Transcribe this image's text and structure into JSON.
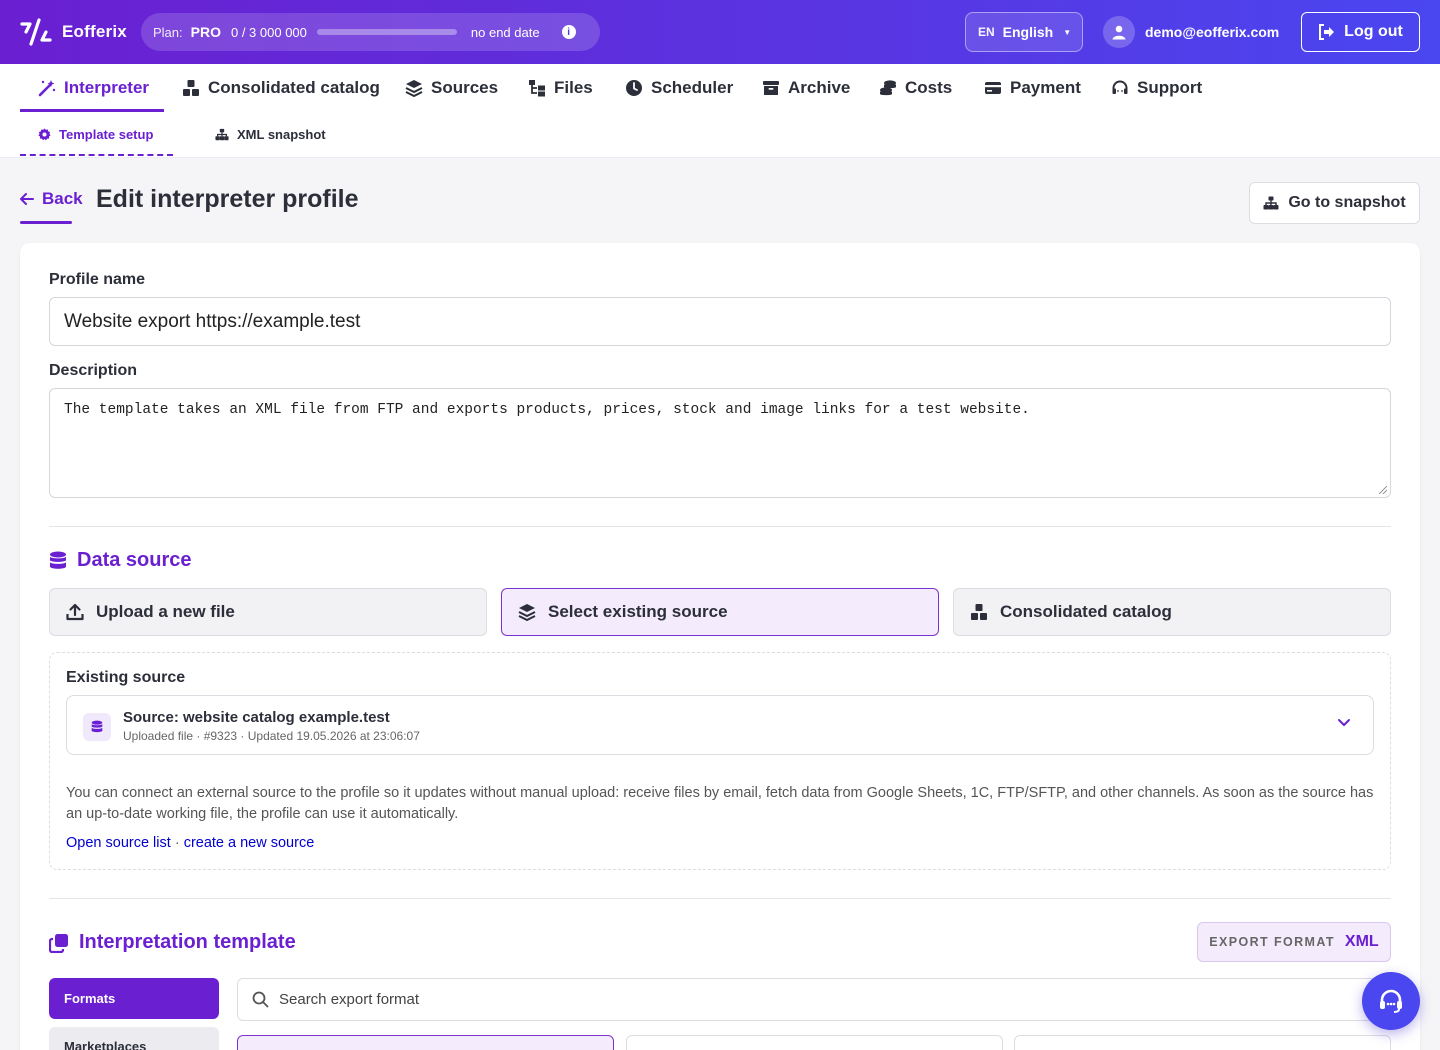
{
  "brand": {
    "name": "Eofferix"
  },
  "plan": {
    "label": "Plan:",
    "name": "PRO",
    "usage": "0 / 3 000 000",
    "usage_fraction": 0,
    "end": "no end date"
  },
  "lang": {
    "code": "EN",
    "name": "English"
  },
  "user": {
    "email": "demo@eofferix.com"
  },
  "logout_label": "Log out",
  "nav": [
    {
      "label": "Interpreter",
      "icon": "magic-wand-icon",
      "active": true
    },
    {
      "label": "Consolidated catalog",
      "icon": "boxes-icon"
    },
    {
      "label": "Sources",
      "icon": "layers-icon"
    },
    {
      "label": "Files",
      "icon": "folder-tree-icon"
    },
    {
      "label": "Scheduler",
      "icon": "clock-icon"
    },
    {
      "label": "Archive",
      "icon": "archive-icon"
    },
    {
      "label": "Costs",
      "icon": "coins-icon"
    },
    {
      "label": "Payment",
      "icon": "credit-card-icon"
    },
    {
      "label": "Support",
      "icon": "headset-icon"
    }
  ],
  "subnav": [
    {
      "label": "Template setup",
      "icon": "gear-icon",
      "active": true
    },
    {
      "label": "XML snapshot",
      "icon": "sitemap-icon"
    }
  ],
  "page": {
    "back_label": "Back",
    "title": "Edit interpreter profile",
    "snapshot_button": "Go to snapshot"
  },
  "form": {
    "profile_name_label": "Profile name",
    "profile_name_value": "Website export https://example.test",
    "description_label": "Description",
    "description_value": "The template takes an XML file from FTP and exports products, prices, stock and image links for a test website."
  },
  "data_source": {
    "title": "Data source",
    "options": [
      {
        "label": "Upload a new file",
        "icon": "upload-icon",
        "selected": false
      },
      {
        "label": "Select existing source",
        "icon": "layers-icon",
        "selected": true
      },
      {
        "label": "Consolidated catalog",
        "icon": "boxes-icon",
        "selected": false
      }
    ],
    "existing_label": "Existing source",
    "selected_source": {
      "title": "Source: website catalog example.test",
      "subtitle": "Uploaded file · #9323 · Updated 19.05.2026 at 23:06:07"
    },
    "help": "You can connect an external source to the profile so it updates without manual upload: receive files by email, fetch data from Google Sheets, 1C, FTP/SFTP, and other channels. As soon as the source has an up-to-date working file, the profile can use it automatically.",
    "link_list": "Open source list",
    "link_sep": "·",
    "link_create": "create a new source"
  },
  "template": {
    "title": "Interpretation template",
    "export_format_key": "EXPORT FORMAT",
    "export_format_value": "XML",
    "tab_formats": "Formats",
    "tab_marketplaces": "Marketplaces",
    "search_placeholder": "Search export format"
  },
  "colors": {
    "accent": "#6a1fd1",
    "header_gradient_start": "#6a1fd1",
    "header_gradient_end": "#4a46f0",
    "link": "#0000cc"
  }
}
